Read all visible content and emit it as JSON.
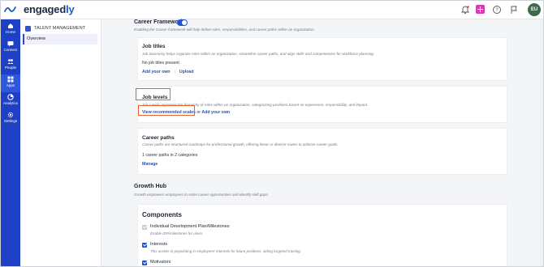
{
  "app": {
    "brand_name": "engagedly",
    "brand_main": "engaged",
    "brand_accent": "ly",
    "avatar_initials": "EU"
  },
  "sidebar": {
    "items": [
      {
        "label": "Home",
        "icon": "home-icon"
      },
      {
        "label": "Connect",
        "icon": "connect-icon"
      },
      {
        "label": "People",
        "icon": "people-icon"
      },
      {
        "label": "Apps",
        "icon": "apps-icon"
      },
      {
        "label": "Analytics",
        "icon": "analytics-icon"
      },
      {
        "label": "Settings",
        "icon": "settings-icon"
      }
    ],
    "active": "Apps"
  },
  "subnav": {
    "heading": "TALENT MANAGEMENT",
    "items": [
      "Overview"
    ]
  },
  "career_framework": {
    "title": "Career Framework",
    "enabled": true,
    "description": "Enabling the Career framework will help define roles, responsibilities, and career paths within an organization."
  },
  "job_titles": {
    "title": "Job titles",
    "description": "Job taxonomy helps organize roles within an organization, streamline career paths, and align skills and competencies for workforce planning.",
    "status": "No job titles present",
    "link_add": "Add your own",
    "link_upload": "Upload",
    "separator": "|"
  },
  "job_levels": {
    "title": "Job levels",
    "description": "Job Levels represent the hierarchy of roles within an organization, categorizing positions based on experience, responsibility, and impact.",
    "link_view": "View recommended scales",
    "connector": "or",
    "link_add": "Add your own"
  },
  "career_paths": {
    "title": "Career paths",
    "description": "Career paths are structured roadmaps for professional growth, offering linear or diverse routes to achieve career goals.",
    "count_text": "1 career paths in 2 categories",
    "link_manage": "Manage"
  },
  "growth_hub": {
    "title": "Growth Hub",
    "description": "Growth empowers employees to seize career opportunities and identify skill gaps."
  },
  "components": {
    "title": "Components",
    "items": [
      {
        "label": "Individual Development Plan/Milestones",
        "sub": "Enable IDP/milestones for users.",
        "checked": true,
        "disabled": true
      },
      {
        "label": "Interests",
        "sub": "This assists in pinpointing in employees' interests for future positions, aiding targeted training.",
        "checked": true,
        "disabled": false
      },
      {
        "label": "Motivators",
        "sub": "",
        "checked": true,
        "disabled": false
      }
    ]
  },
  "colors": {
    "nav_bg": "#1e40c4",
    "link": "#1a55c8",
    "highlight": "#e8622f",
    "toggle_on": "#2152d8",
    "add_button": "#d63ab5"
  }
}
